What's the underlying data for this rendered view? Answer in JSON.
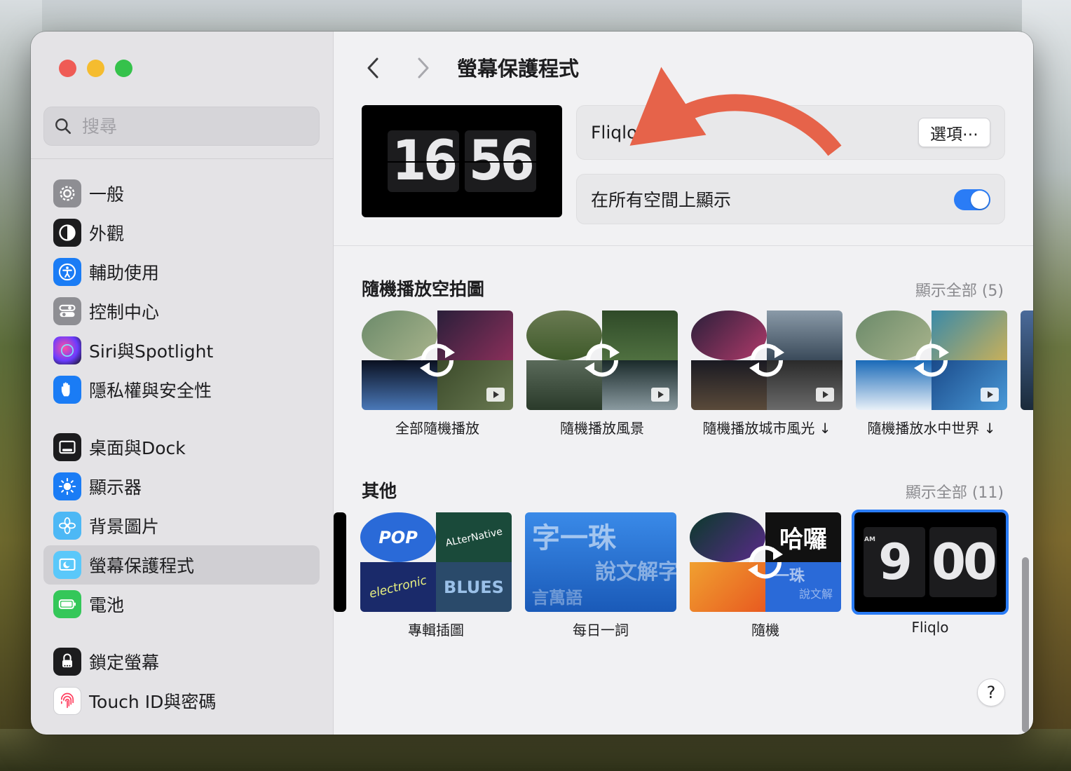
{
  "search": {
    "placeholder": "搜尋"
  },
  "sidebar": {
    "items": [
      {
        "label": "一般",
        "icon": "gear-icon"
      },
      {
        "label": "外觀",
        "icon": "appearance-icon"
      },
      {
        "label": "輔助使用",
        "icon": "accessibility-icon"
      },
      {
        "label": "控制中心",
        "icon": "control-center-icon"
      },
      {
        "label": "Siri與Spotlight",
        "icon": "siri-icon"
      },
      {
        "label": "隱私權與安全性",
        "icon": "hand-icon"
      },
      {
        "label": "桌面與Dock",
        "icon": "dock-icon"
      },
      {
        "label": "顯示器",
        "icon": "sun-icon"
      },
      {
        "label": "背景圖片",
        "icon": "flower-icon"
      },
      {
        "label": "螢幕保護程式",
        "icon": "screensaver-icon"
      },
      {
        "label": "電池",
        "icon": "battery-icon"
      },
      {
        "label": "鎖定螢幕",
        "icon": "lock-icon"
      },
      {
        "label": "Touch ID與密碼",
        "icon": "fingerprint-icon"
      }
    ]
  },
  "header": {
    "title": "螢幕保護程式"
  },
  "preview": {
    "hours": "16",
    "minutes": "56"
  },
  "current": {
    "name": "Fliqlo",
    "options_label": "選項⋯"
  },
  "all_spaces": {
    "label": "在所有空間上顯示",
    "enabled": true
  },
  "aerial": {
    "title": "隨機播放空拍圖",
    "show_all": "顯示全部 (5)",
    "items": [
      {
        "caption": "全部隨機播放"
      },
      {
        "caption": "隨機播放風景"
      },
      {
        "caption": "隨機播放城市風光 ↓"
      },
      {
        "caption": "隨機播放水中世界 ↓"
      }
    ]
  },
  "other": {
    "title": "其他",
    "show_all": "顯示全部 (11)",
    "items": [
      {
        "caption": "專輯插圖",
        "tile_texts": [
          "POP",
          "ALterNative",
          "electronic",
          "BLUES"
        ]
      },
      {
        "caption": "每日一詞",
        "tile_texts": [
          "字一珠",
          "說文解字",
          "言萬語"
        ]
      },
      {
        "caption": "隨機",
        "tile_texts": [
          "哈囉",
          "一珠",
          "說文解"
        ]
      },
      {
        "caption": "Fliqlo",
        "tile_texts": [
          "AM",
          "9",
          "00"
        ]
      }
    ]
  },
  "colors": {
    "accent": "#2a7cf6",
    "arrow": "#e6634a"
  }
}
